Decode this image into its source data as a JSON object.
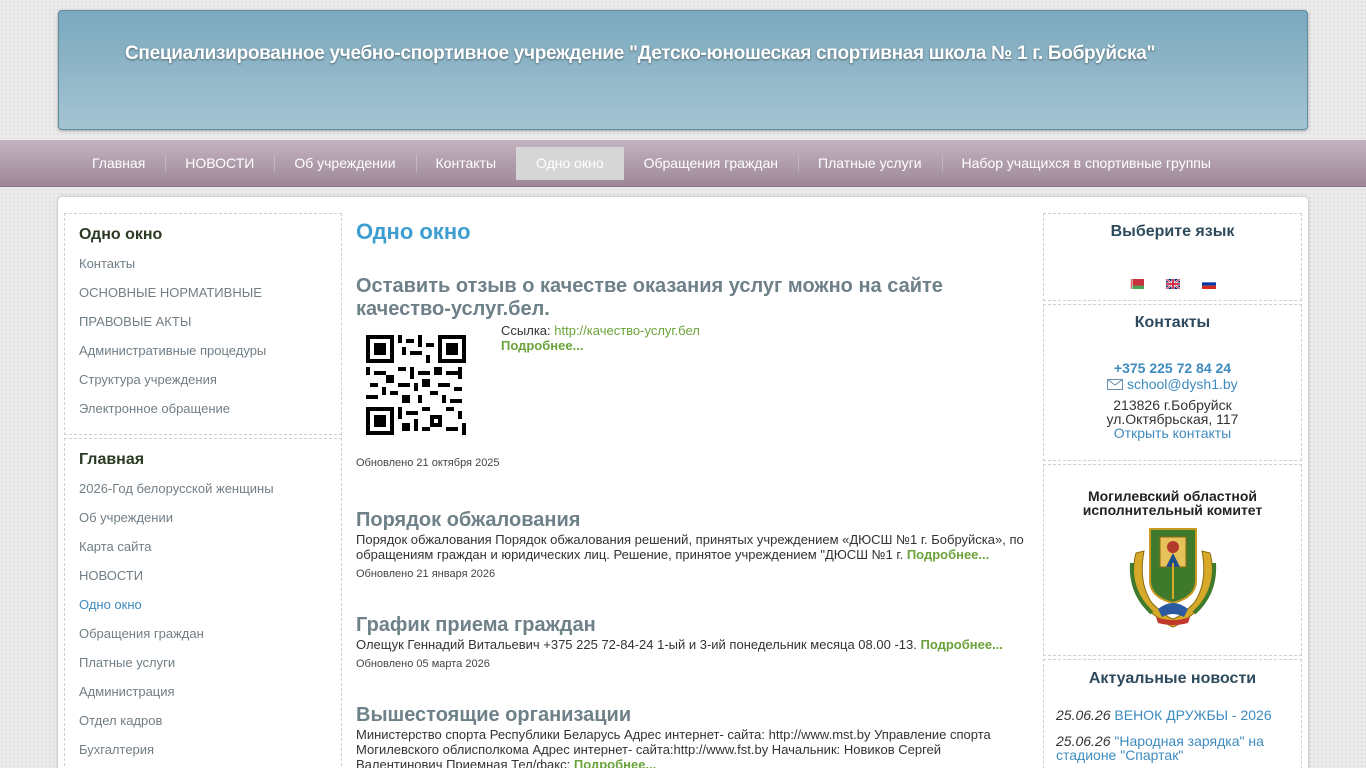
{
  "header": {
    "title": "Специализированное учебно-спортивное учреждение \"Детско-юношеская спортивная школа № 1 г. Бобруйска\""
  },
  "nav": {
    "items": [
      "Главная",
      "НОВОСТИ",
      "Об учреждении",
      "Контакты",
      "Одно окно",
      "Обращения граждан",
      "Платные услуги",
      "Набор учащихся в спортивные группы"
    ],
    "active": "Одно окно"
  },
  "left_menu_1": {
    "title": "Одно окно",
    "items": [
      "Контакты",
      "ОСНОВНЫЕ НОРМАТИВНЫЕ",
      "ПРАВОВЫЕ АКТЫ",
      "Административные процедуры",
      "Структура учреждения",
      "Электронное обращение"
    ]
  },
  "left_menu_2": {
    "title": "Главная",
    "items": [
      "2026-Год белорусской женщины",
      "Об учреждении",
      "Карта сайта",
      "НОВОСТИ",
      "Одно окно",
      "Обращения граждан",
      "Платные услуги",
      "Администрация",
      "Отдел кадров",
      "Бухгалтерия"
    ]
  },
  "main": {
    "page_title": "Одно окно",
    "articles": [
      {
        "title": "Оставить отзыв о качестве оказания услуг можно на сайте качество-услуг.бел.",
        "link_label": "Ссылка:",
        "link_url": "http://качество-услуг.бел",
        "more": "Подробнее...",
        "updated": "Обновлено 21 октября 2025"
      },
      {
        "title": "Порядок обжалования",
        "text": "Порядок обжалования Порядок обжалования решений, принятых учреждением «ДЮСШ №1 г. Бобруйска», по обращениям граждан и юридических лиц. Решение, принятое учреждением \"ДЮСШ №1 г.",
        "more": "Подробнее...",
        "updated": "Обновлено 21 января 2026"
      },
      {
        "title": "График приема граждан",
        "text": "Олещук Геннадий Витальевич +375 225 72-84-24 1-ый и 3-ий понедельник месяца 08.00 -13.",
        "more": "Подробнее...",
        "updated": "Обновлено 05 марта 2026"
      },
      {
        "title": "Вышестоящие организации",
        "text": "Министерство спорта Республики Беларусь Адрес интернет- сайта: http://www.mst.by Управление спорта Могилевского облисполкома Адрес интернет- сайта:http://www.fst.by Начальник: Новиков Сергей Валентинович Приемная Тел/факс:",
        "more": "Подробнее..."
      }
    ]
  },
  "right": {
    "lang_title": "Выберите язык",
    "contacts_title": "Контакты",
    "phone": "+375 225 72 84 24",
    "email": "school@dysh1.by",
    "address_1": "213826 г.Бобруйск",
    "address_2": "ул.Октябрьская, 117",
    "open_contacts": "Открыть контакты",
    "oblast_title": "Могилевский областной исполнительный комитет",
    "news_title": "Актуальные новости",
    "news": [
      {
        "date": "25.06.26",
        "title": "ВЕНОК ДРУЖБЫ - 2026"
      },
      {
        "date": "25.06.26",
        "title": "\"Народная зарядка\" на стадионе \"Спартак\""
      }
    ]
  }
}
